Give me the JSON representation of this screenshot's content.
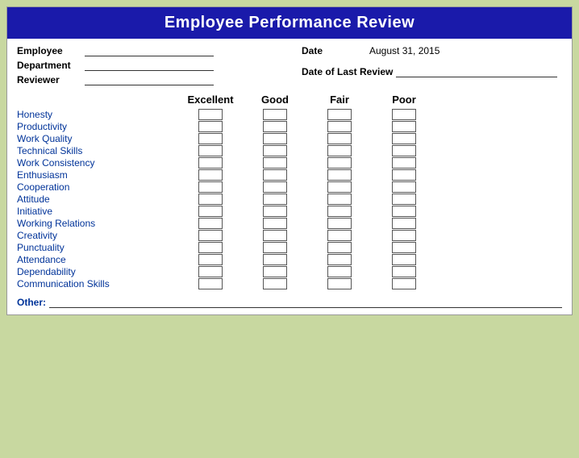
{
  "title": "Employee Performance Review",
  "fields": {
    "employee_label": "Employee",
    "department_label": "Department",
    "reviewer_label": "Reviewer",
    "date_label": "Date",
    "date_value": "August 31, 2015",
    "date_last_review_label": "Date of Last Review"
  },
  "ratings_headers": [
    "Excellent",
    "Good",
    "Fair",
    "Poor"
  ],
  "criteria": [
    "Honesty",
    "Productivity",
    "Work Quality",
    "Technical Skills",
    "Work Consistency",
    "Enthusiasm",
    "Cooperation",
    "Attitude",
    "Initiative",
    "Working Relations",
    "Creativity",
    "Punctuality",
    "Attendance",
    "Dependability",
    "Communication Skills"
  ],
  "other_label": "Other:"
}
